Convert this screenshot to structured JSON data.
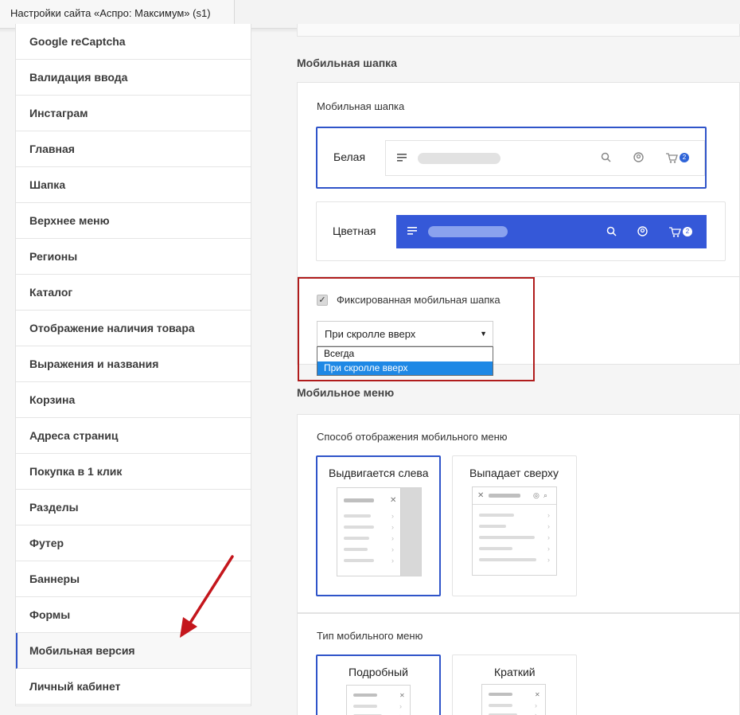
{
  "window": {
    "tab_title": "Настройки сайта «Аспро: Максимум» (s1)"
  },
  "sidebar": {
    "items": [
      {
        "label": "Google reCaptcha",
        "active": false
      },
      {
        "label": "Валидация ввода",
        "active": false
      },
      {
        "label": "Инстаграм",
        "active": false
      },
      {
        "label": "Главная",
        "active": false
      },
      {
        "label": "Шапка",
        "active": false
      },
      {
        "label": "Верхнее меню",
        "active": false
      },
      {
        "label": "Регионы",
        "active": false
      },
      {
        "label": "Каталог",
        "active": false
      },
      {
        "label": "Отображение наличия товара",
        "active": false
      },
      {
        "label": "Выражения и названия",
        "active": false
      },
      {
        "label": "Корзина",
        "active": false
      },
      {
        "label": "Адреса страниц",
        "active": false
      },
      {
        "label": "Покупка в 1 клик",
        "active": false
      },
      {
        "label": "Разделы",
        "active": false
      },
      {
        "label": "Футер",
        "active": false
      },
      {
        "label": "Баннеры",
        "active": false
      },
      {
        "label": "Формы",
        "active": false
      },
      {
        "label": "Мобильная версия",
        "active": true
      },
      {
        "label": "Личный кабинет",
        "active": false
      }
    ]
  },
  "mobile_header": {
    "section_title": "Мобильная шапка",
    "panel_label": "Мобильная шапка",
    "options": [
      {
        "label": "Белая",
        "selected": true,
        "cart_count": "2"
      },
      {
        "label": "Цветная",
        "selected": false,
        "cart_count": "2"
      }
    ],
    "fixed_checkbox": {
      "label": "Фиксированная мобильная шапка",
      "checked": true
    },
    "fixed_select": {
      "value": "При скролле вверх",
      "options": [
        "Всегда",
        "При скролле вверх"
      ],
      "highlighted": "При скролле вверх"
    }
  },
  "mobile_menu": {
    "section_title": "Мобильное меню",
    "display_label": "Способ отображения мобильного меню",
    "display_options": [
      {
        "label": "Выдвигается слева",
        "selected": true
      },
      {
        "label": "Выпадает сверху",
        "selected": false
      }
    ],
    "type_label": "Тип мобильного меню",
    "type_options": [
      {
        "label": "Подробный",
        "selected": true
      },
      {
        "label": "Краткий",
        "selected": false
      }
    ]
  },
  "colors": {
    "accent": "#2f54c9",
    "header_blue": "#3558d8",
    "highlight_red": "#b01c1c",
    "arrow_red": "#c4161c"
  }
}
